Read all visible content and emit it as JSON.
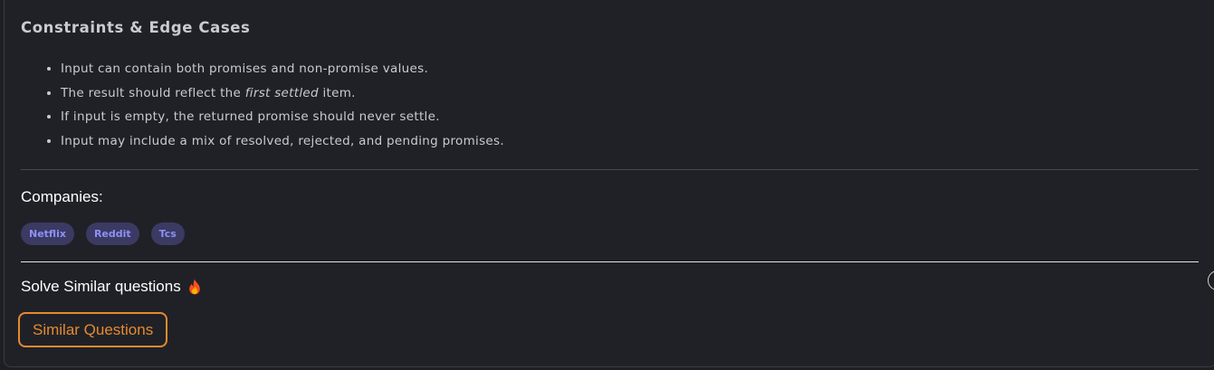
{
  "constraints": {
    "title": "Constraints & Edge Cases",
    "items": [
      {
        "before": "Input can contain both promises and non-promise values.",
        "emphasis": "",
        "after": ""
      },
      {
        "before": "The result should reflect the ",
        "emphasis": "first settled",
        "after": " item."
      },
      {
        "before": "If input is empty, the returned promise should never settle.",
        "emphasis": "",
        "after": ""
      },
      {
        "before": "Input may include a mix of resolved, rejected, and pending promises.",
        "emphasis": "",
        "after": ""
      }
    ]
  },
  "companies": {
    "label": "Companies:",
    "tags": [
      "Netflix",
      "Reddit",
      "Tcs"
    ]
  },
  "similar": {
    "heading": "Solve Similar questions",
    "icon": "flame-icon",
    "button_label": "Similar Questions",
    "accent_color": "#e58a2e"
  },
  "colors": {
    "background": "#202127",
    "tag_background": "#3a3a63",
    "tag_text": "#8f8ff5",
    "body_text": "#c9cbd1"
  }
}
